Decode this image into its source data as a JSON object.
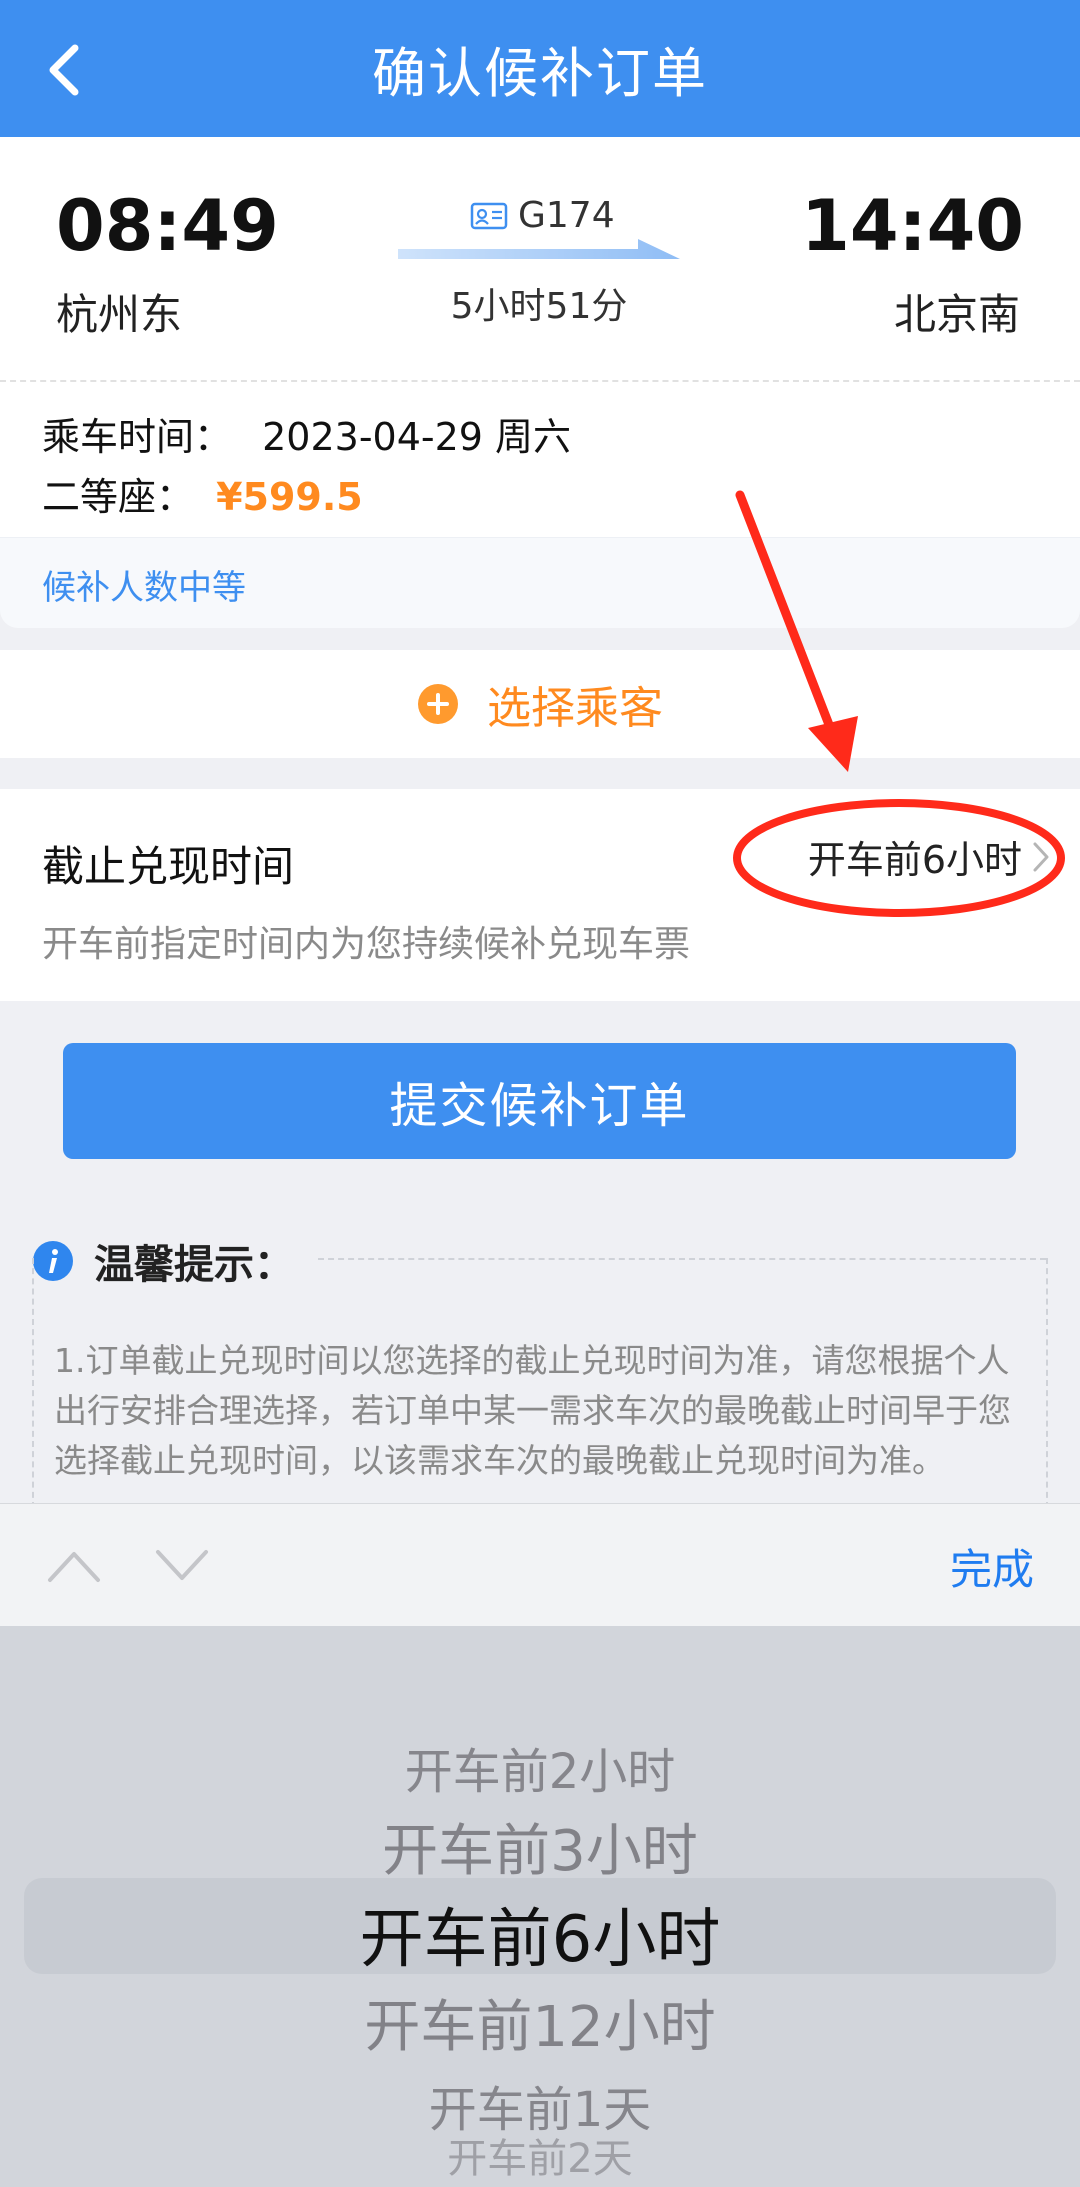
{
  "header": {
    "title": "确认候补订单"
  },
  "train": {
    "departure_time": "08:49",
    "departure_station": "杭州东",
    "arrival_time": "14:40",
    "arrival_station": "北京南",
    "train_no": "G174",
    "duration": "5小时51分"
  },
  "info": {
    "ride_date_label": "乘车时间：",
    "ride_date": "2023-04-29 周六",
    "seat_label": "二等座：",
    "price": "¥599.5",
    "wait_status": "候补人数中等"
  },
  "passenger": {
    "select_label": "选择乘客"
  },
  "deadline": {
    "label": "截止兑现时间",
    "value": "开车前6小时",
    "sub": "开车前指定时间内为您持续候补兑现车票"
  },
  "submit": {
    "label": "提交候补订单"
  },
  "tips": {
    "title": "温馨提示：",
    "body": "1.订单截止兑现时间以您选择的截止兑现时间为准，请您根据个人出行安排合理选择，若订单中某一需求车次的最晚截止时间早于您选择截止兑现时间，以该需求车次的最晚截止兑现时间为准。"
  },
  "picker": {
    "done_label": "完成",
    "options": [
      "开车前2小时",
      "开车前3小时",
      "开车前6小时",
      "开车前12小时",
      "开车前1天",
      "开车前2天"
    ],
    "selected_index": 2
  },
  "colors": {
    "brand_blue": "#3e8ff0",
    "price_orange": "#ff8a1f",
    "annotation_red": "#ff2a1a"
  }
}
